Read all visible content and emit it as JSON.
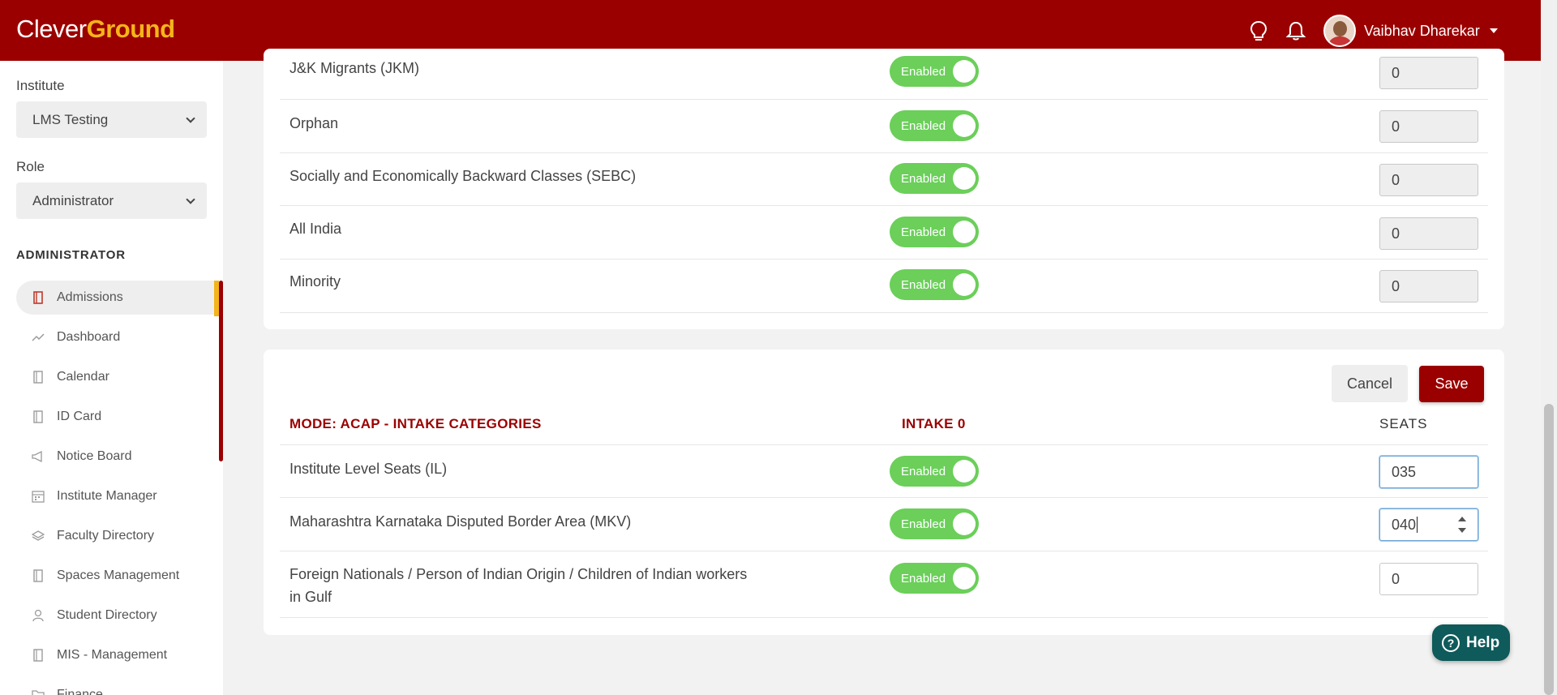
{
  "header": {
    "logo_part1": "Clever",
    "logo_part2": "Ground",
    "user_name": "Vaibhav Dharekar",
    "bg_color": "#9b0000",
    "logo_accent": "#f4b41a"
  },
  "sidebar": {
    "institute_label": "Institute",
    "institute_value": "LMS Testing",
    "role_label": "Role",
    "role_value": "Administrator",
    "section_title": "ADMINISTRATOR",
    "items": [
      {
        "label": "Admissions",
        "icon": "book-icon",
        "active": true
      },
      {
        "label": "Dashboard",
        "icon": "trend-icon"
      },
      {
        "label": "Calendar",
        "icon": "book-icon"
      },
      {
        "label": "ID Card",
        "icon": "book-icon"
      },
      {
        "label": "Notice Board",
        "icon": "megaphone-icon"
      },
      {
        "label": "Institute Manager",
        "icon": "calendar-icon"
      },
      {
        "label": "Faculty Directory",
        "icon": "layers-icon"
      },
      {
        "label": "Spaces Management",
        "icon": "book-icon"
      },
      {
        "label": "Student Directory",
        "icon": "user-icon"
      },
      {
        "label": "MIS - Management",
        "icon": "book-icon"
      },
      {
        "label": "Finance",
        "icon": "folder-icon"
      }
    ]
  },
  "top_card": {
    "rows": [
      {
        "label": "J&K Migrants (JKM)",
        "status": "Enabled",
        "seats": "0"
      },
      {
        "label": "Orphan",
        "status": "Enabled",
        "seats": "0"
      },
      {
        "label": "Socially and Economically Backward Classes (SEBC)",
        "status": "Enabled",
        "seats": "0"
      },
      {
        "label": "All India",
        "status": "Enabled",
        "seats": "0"
      },
      {
        "label": "Minority",
        "status": "Enabled",
        "seats": "0"
      }
    ]
  },
  "intake_card": {
    "cancel_label": "Cancel",
    "save_label": "Save",
    "mode_header": "MODE: ACAP - INTAKE CATEGORIES",
    "intake_header": "INTAKE 0",
    "seats_header": "SEATS",
    "rows": [
      {
        "label": "Institute Level Seats (IL)",
        "status": "Enabled",
        "seats": "035"
      },
      {
        "label": "Maharashtra Karnataka Disputed Border Area (MKV)",
        "status": "Enabled",
        "seats": "040"
      },
      {
        "label_line1": "Foreign Nationals / Person of Indian Origin / Children of Indian workers",
        "label_line2": "in Gulf",
        "status": "Enabled",
        "seats": "0"
      }
    ]
  },
  "help_label": "Help",
  "colors": {
    "toggle_on": "#6bcf5a",
    "accent_red": "#9b0000",
    "active_marker": "#f4b41a"
  }
}
